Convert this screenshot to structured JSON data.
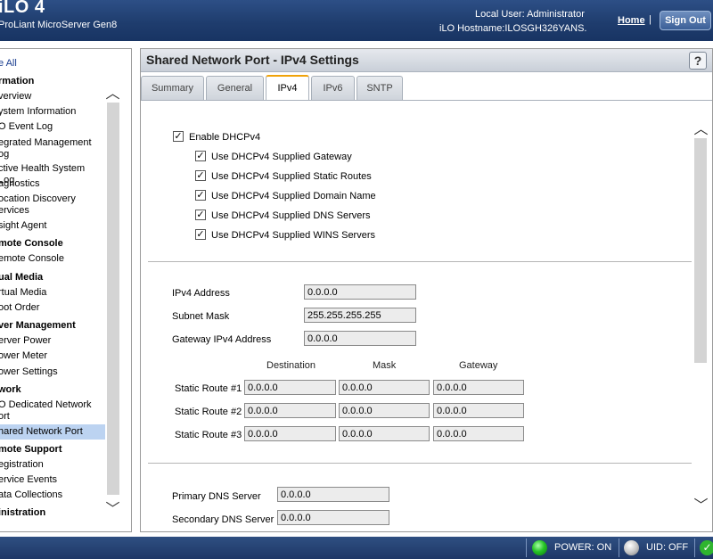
{
  "header": {
    "product": "iLO 4",
    "server": "ProLiant MicroServer Gen8",
    "local_user": "Local User:  Administrator",
    "hostname": "iLO Hostname:ILOSGH326YANS.",
    "home": "Home",
    "separator": "|",
    "sign_out": "Sign Out"
  },
  "sidebar": {
    "expand_all": "e All",
    "groups": [
      {
        "label": "rmation",
        "items": [
          "verview",
          "ystem Information",
          "O Event Log",
          "egrated Management\nog",
          "ctive Health System Log",
          "agnostics",
          "ocation Discovery\nervices",
          "sight Agent"
        ]
      },
      {
        "label": "mote Console",
        "items": [
          "emote Console"
        ]
      },
      {
        "label": "ual Media",
        "items": [
          "rtual Media",
          "oot Order"
        ]
      },
      {
        "label": "ver Management",
        "items": [
          "erver Power",
          "ower Meter",
          "ower Settings"
        ]
      },
      {
        "label": "work",
        "items": [
          "O Dedicated Network\nort",
          "hared Network Port"
        ]
      },
      {
        "label": "mote Support",
        "items": [
          "egistration",
          "ervice Events",
          "ata Collections"
        ]
      },
      {
        "label": "inistration",
        "items": []
      }
    ]
  },
  "main": {
    "title": "Shared Network Port - IPv4 Settings",
    "help": "?",
    "tabs": [
      {
        "label": "Summary"
      },
      {
        "label": "General"
      },
      {
        "label": "IPv4"
      },
      {
        "label": "IPv6"
      },
      {
        "label": "SNTP"
      }
    ],
    "active_tab": "IPv4",
    "enable_dhcp": {
      "label": "Enable DHCPv4",
      "checked": true
    },
    "dhcp_options": [
      {
        "label": "Use DHCPv4 Supplied Gateway",
        "checked": true
      },
      {
        "label": "Use DHCPv4 Supplied Static Routes",
        "checked": true
      },
      {
        "label": "Use DHCPv4 Supplied Domain Name",
        "checked": true
      },
      {
        "label": "Use DHCPv4 Supplied DNS Servers",
        "checked": true
      },
      {
        "label": "Use DHCPv4 Supplied WINS Servers",
        "checked": true
      }
    ],
    "check_glyph": "✓",
    "ipv4_address": {
      "label": "IPv4 Address",
      "value": "0.0.0.0"
    },
    "subnet_mask": {
      "label": "Subnet Mask",
      "value": "255.255.255.255"
    },
    "gateway": {
      "label": "Gateway IPv4 Address",
      "value": "0.0.0.0"
    },
    "route_headers": {
      "destination": "Destination",
      "mask": "Mask",
      "gateway": "Gateway"
    },
    "static_routes": [
      {
        "label": "Static Route #1",
        "destination": "0.0.0.0",
        "mask": "0.0.0.0",
        "gateway": "0.0.0.0"
      },
      {
        "label": "Static Route #2",
        "destination": "0.0.0.0",
        "mask": "0.0.0.0",
        "gateway": "0.0.0.0"
      },
      {
        "label": "Static Route #3",
        "destination": "0.0.0.0",
        "mask": "0.0.0.0",
        "gateway": "0.0.0.0"
      }
    ],
    "primary_dns": {
      "label": "Primary DNS Server",
      "value": "0.0.0.0"
    },
    "secondary_dns": {
      "label": "Secondary DNS Server",
      "value": "0.0.0.0"
    }
  },
  "footer": {
    "power": "POWER: ON",
    "uid": "UID: OFF",
    "status_check": "✓",
    "power_color": "#27c427",
    "uid_color": "#c8c8c8"
  },
  "scroll": {
    "up": "︿",
    "down": "﹀"
  }
}
